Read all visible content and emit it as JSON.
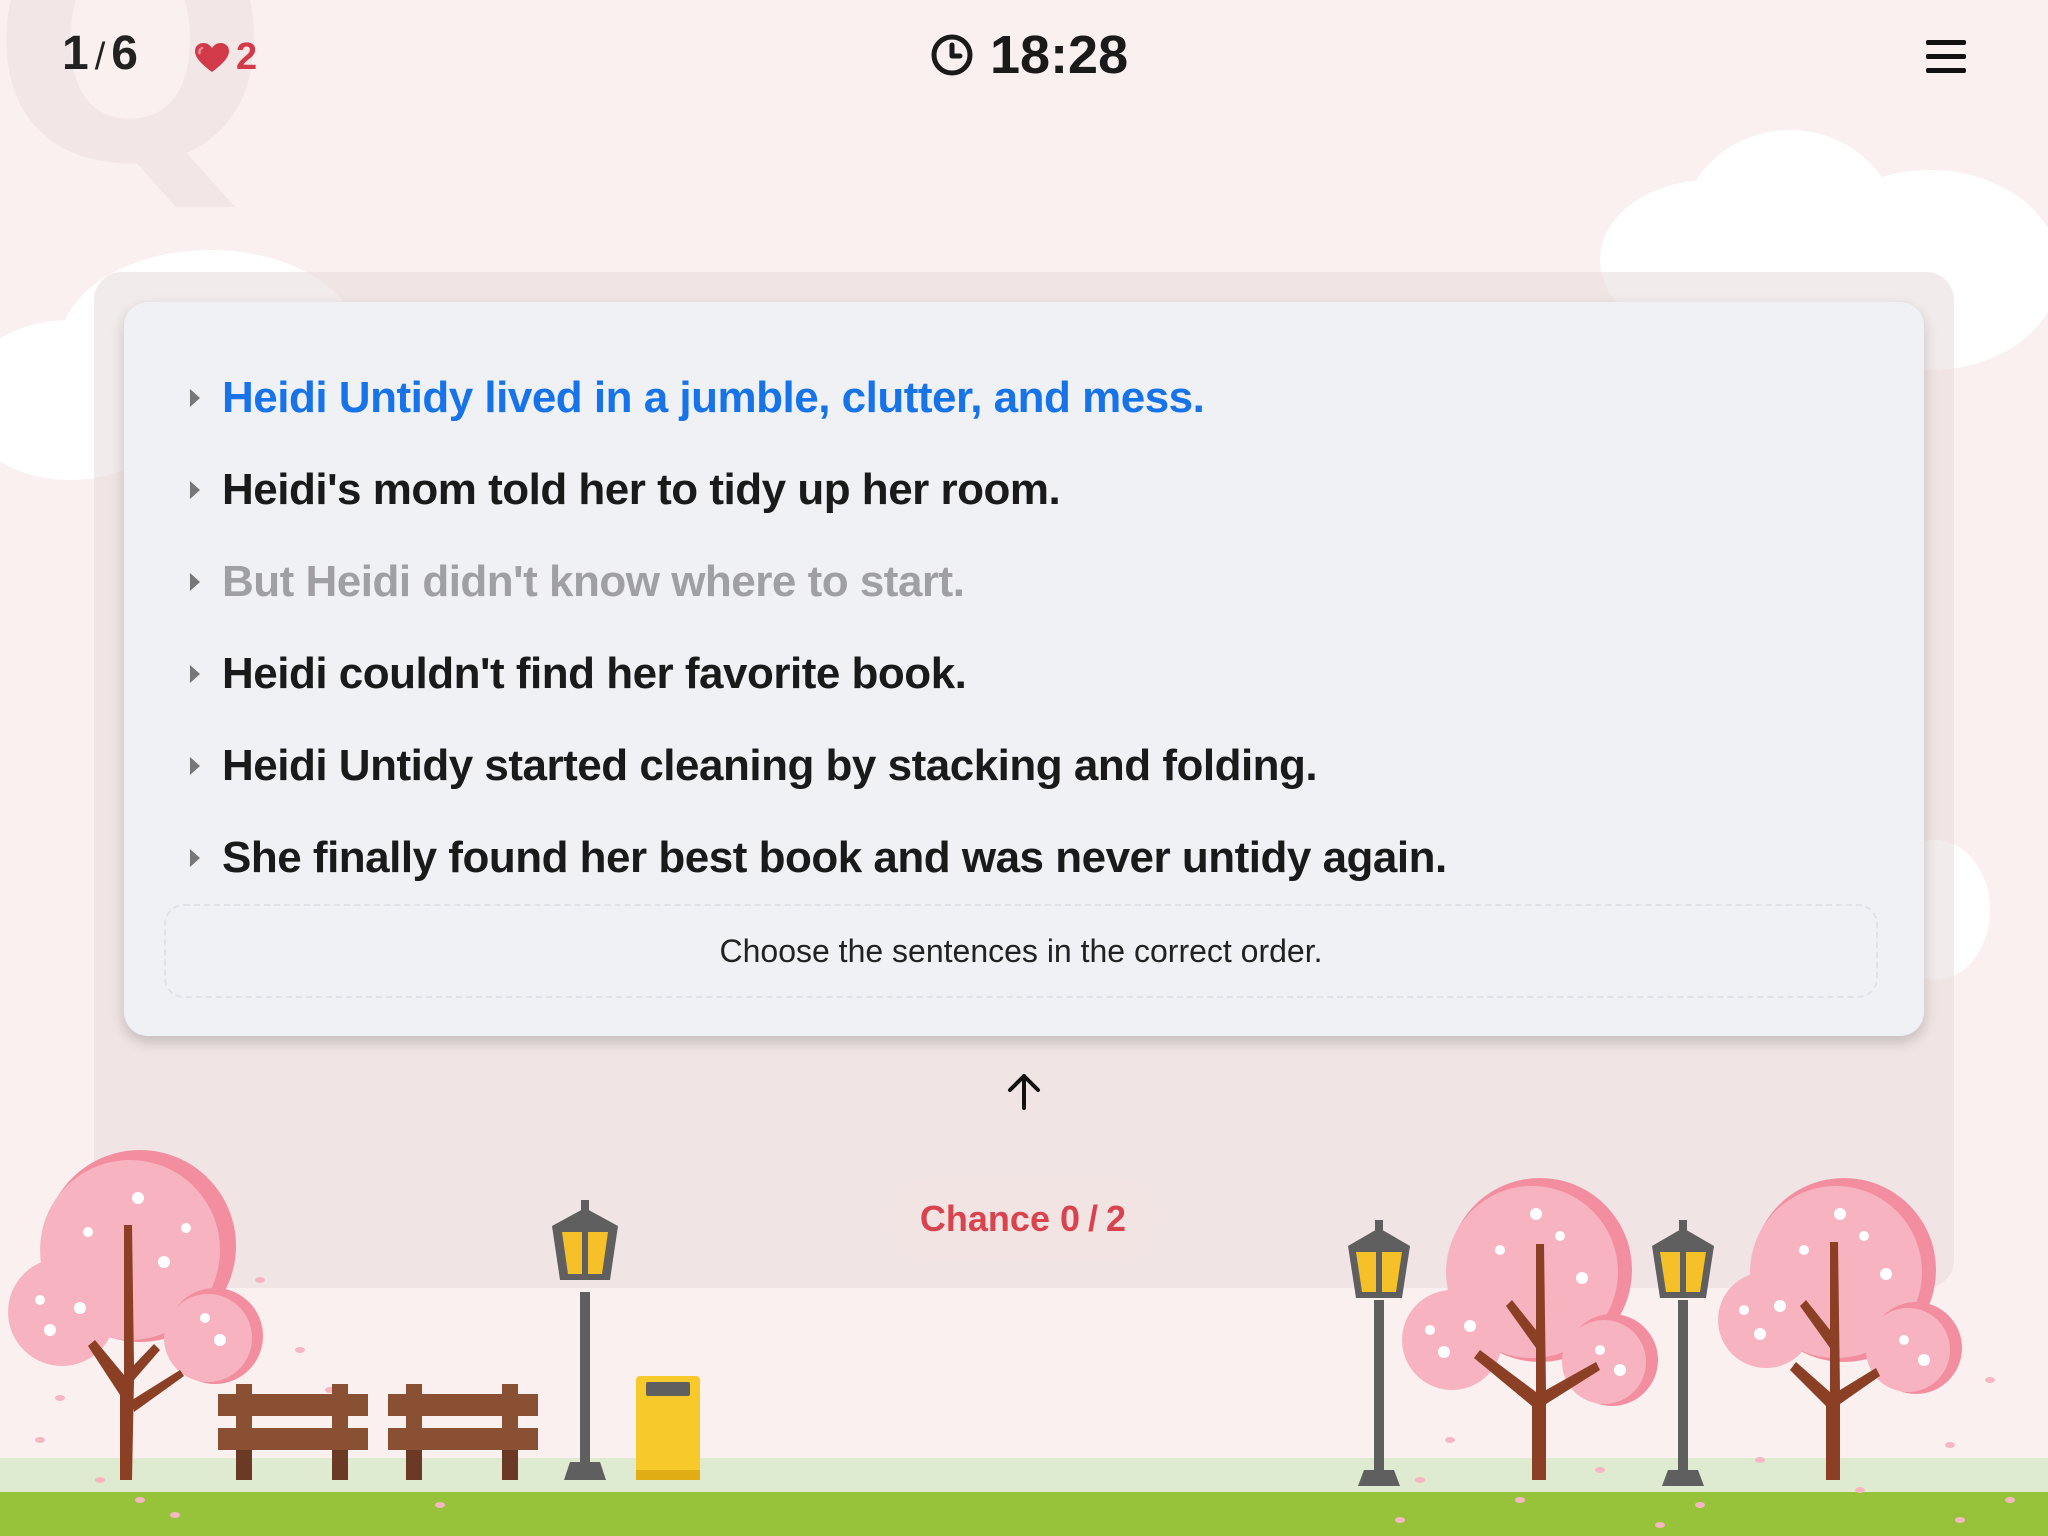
{
  "header": {
    "progress_current": "1",
    "progress_separator": "/",
    "progress_total": "6",
    "lives": "2",
    "timer": "18:28"
  },
  "icons": {
    "lives": "heart-icon",
    "timer": "clock-icon",
    "menu": "hamburger-menu-icon",
    "submit": "arrow-up-icon"
  },
  "sentences": [
    {
      "text": "Heidi Untidy lived in a jumble, clutter, and mess.",
      "state": "selected"
    },
    {
      "text": "Heidi's mom told her to tidy up her room.",
      "state": "normal"
    },
    {
      "text": "But Heidi didn't know where to start.",
      "state": "dimmed"
    },
    {
      "text": "Heidi couldn't find her favorite book.",
      "state": "normal"
    },
    {
      "text": "Heidi Untidy started cleaning by stacking and folding.",
      "state": "normal"
    },
    {
      "text": "She finally found her best book and was never untidy again.",
      "state": "normal"
    }
  ],
  "instruction": "Choose the sentences in the correct order.",
  "chance": {
    "label": "Chance",
    "used": "0",
    "separator": "/",
    "total": "2"
  },
  "colors": {
    "selected": "#1673ea",
    "dimmed": "#a0a0a4",
    "chance": "#d8434e",
    "lives": "#d23a4a",
    "grass": "#97c33b"
  }
}
